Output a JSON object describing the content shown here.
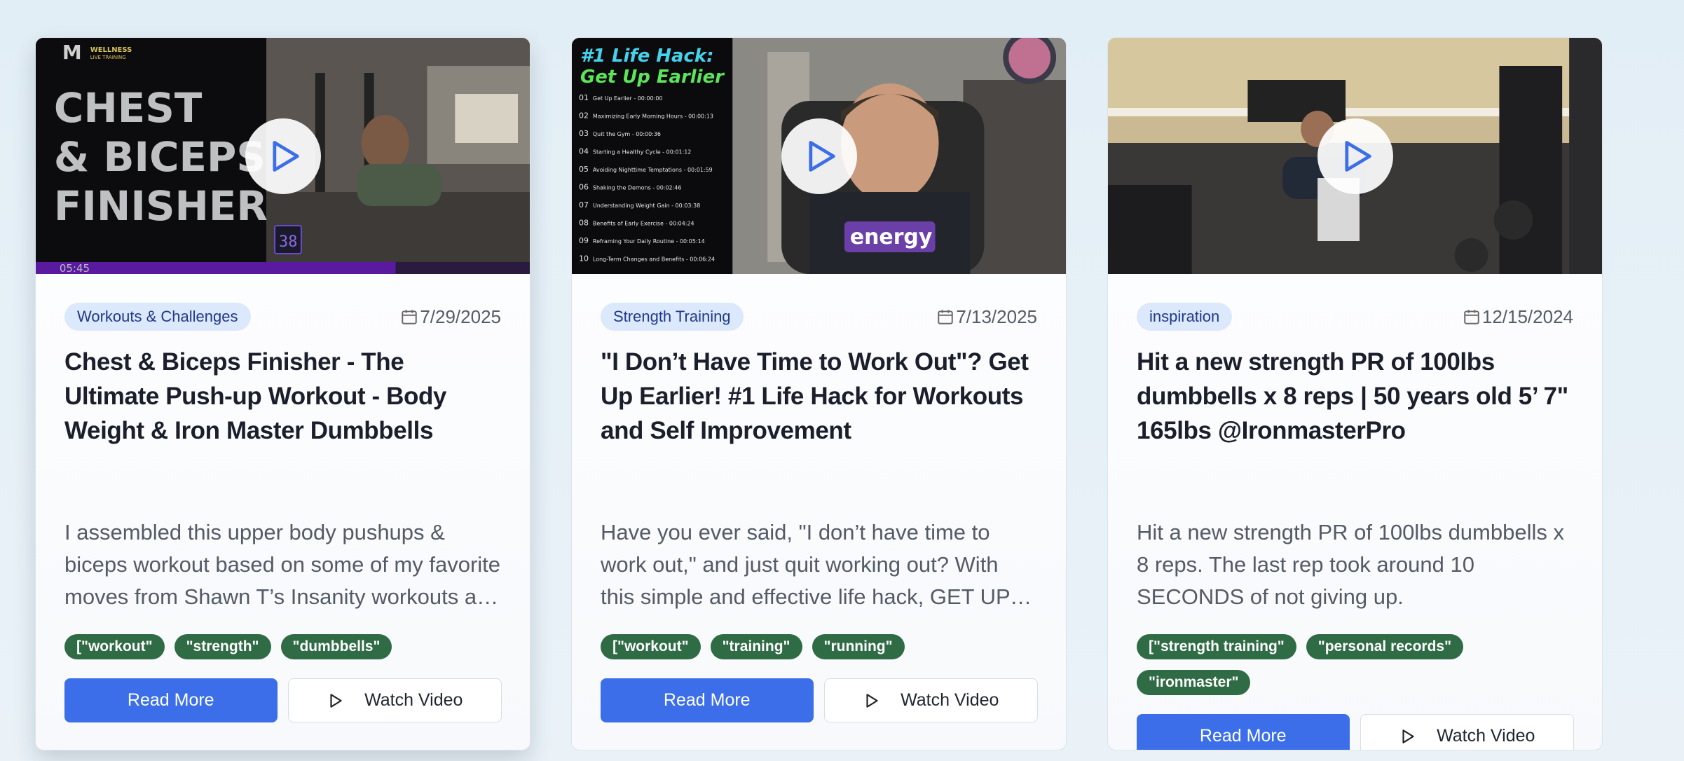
{
  "cards": [
    {
      "thumbnail": {
        "overlay_lines": [
          "CHEST",
          "& BICEPS",
          "FINISHER"
        ],
        "brand_lines": [
          "M",
          "WELLNESS",
          "LIVE TRAINING"
        ],
        "timer": "05:45",
        "counter": "38"
      },
      "category": "Workouts & Challenges",
      "date": "7/29/2025",
      "title": "Chest & Biceps Finisher - The Ultimate Push-up Workout - Body Weight & Iron Master Dumbbells",
      "description": "I assembled this upper body pushups & biceps workout based on some of my favorite moves from Shawn T’s Insanity workouts and added some dumbbell moves.",
      "tags": [
        "[\"workout\"",
        "\"strength\"",
        "\"dumbbells\""
      ],
      "read_more": "Read More",
      "watch_video": "Watch Video"
    },
    {
      "thumbnail": {
        "heading_lines": [
          "#1 Life Hack:",
          "Get Up Earlier"
        ],
        "chapters": [
          {
            "num": "01",
            "text": "Get Up Earlier - 00:00:00"
          },
          {
            "num": "02",
            "text": "Maximizing Early Morning Hours - 00:00:13"
          },
          {
            "num": "03",
            "text": "Quit the Gym - 00:00:36"
          },
          {
            "num": "04",
            "text": "Starting a Healthy Cycle - 00:01:12"
          },
          {
            "num": "05",
            "text": "Avoiding Nighttime Temptations - 00:01:59"
          },
          {
            "num": "06",
            "text": "Shaking the Demons - 00:02:46"
          },
          {
            "num": "07",
            "text": "Understanding Weight Gain - 00:03:38"
          },
          {
            "num": "08",
            "text": "Benefits of Early Exercise - 00:04:24"
          },
          {
            "num": "09",
            "text": "Reframing Your Daily Routine - 00:05:14"
          },
          {
            "num": "10",
            "text": "Long-Term Changes and Benefits - 00:06:24"
          }
        ],
        "caption": "energy"
      },
      "category": "Strength Training",
      "date": "7/13/2025",
      "title": "\"I Don’t Have Time to Work Out\"? Get Up Earlier! #1 Life Hack for Workouts and Self Improvement",
      "description": "Have you ever said, \"I don’t have time to work out,\" and just quit working out? With this simple and effective life hack, GET UP EARLIER, you can change everything.",
      "tags": [
        "[\"workout\"",
        "\"training\"",
        "\"running\""
      ],
      "read_more": "Read More",
      "watch_video": "Watch Video"
    },
    {
      "thumbnail": {},
      "category": "inspiration",
      "date": "12/15/2024",
      "title": "Hit a new strength PR of 100lbs dumbbells x 8 reps | 50 years old 5’ 7\" 165lbs @IronmasterPro",
      "description": "Hit a new strength PR of 100lbs dumbbells x 8 reps. The last rep took around 10 SECONDS of not giving up.",
      "tags": [
        "[\"strength training\"",
        "\"personal records\"",
        "\"ironmaster\""
      ],
      "read_more": "Read More",
      "watch_video": "Watch Video"
    }
  ],
  "colors": {
    "primary_button": "#3b6ee8",
    "category_bg": "#dce8fb",
    "category_text": "#1e3a8a",
    "tag_bg": "#2f6b44",
    "play_icon": "#3b6ee8"
  },
  "icons": {
    "play_overlay": "play-circle-icon",
    "date": "calendar-icon",
    "watch": "play-outline-icon"
  }
}
